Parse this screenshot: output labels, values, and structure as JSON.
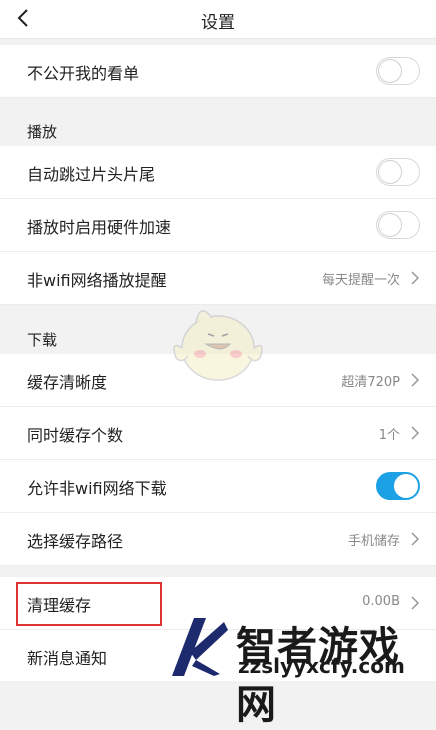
{
  "header": {
    "title": "设置",
    "back_icon": "chevron-left-icon"
  },
  "rows": {
    "private_list": {
      "label": "不公开我的看单",
      "toggle_on": false
    },
    "skip_intro": {
      "label": "自动跳过片头片尾",
      "toggle_on": false
    },
    "hw_accel": {
      "label": "播放时启用硬件加速",
      "toggle_on": false
    },
    "non_wifi_play": {
      "label": "非wifi网络播放提醒",
      "value": "每天提醒一次"
    },
    "cache_quality": {
      "label": "缓存清晰度",
      "value": "超清720P"
    },
    "concurrent_cache": {
      "label": "同时缓存个数",
      "value": "1个"
    },
    "non_wifi_download": {
      "label": "允许非wifi网络下载",
      "toggle_on": true
    },
    "cache_path": {
      "label": "选择缓存路径",
      "value": "手机储存"
    },
    "clear_cache": {
      "label": "清理缓存",
      "value": "0.00B"
    },
    "notifications": {
      "label": "新消息通知"
    }
  },
  "sections": {
    "playback": "播放",
    "download": "下载"
  },
  "watermark": {
    "text": "智者游戏网",
    "url": "zzslyyxcfy.com",
    "logo_icon": "brand-logo-icon"
  },
  "colors": {
    "accent": "#1da1e6",
    "highlight": "#dd3333"
  }
}
